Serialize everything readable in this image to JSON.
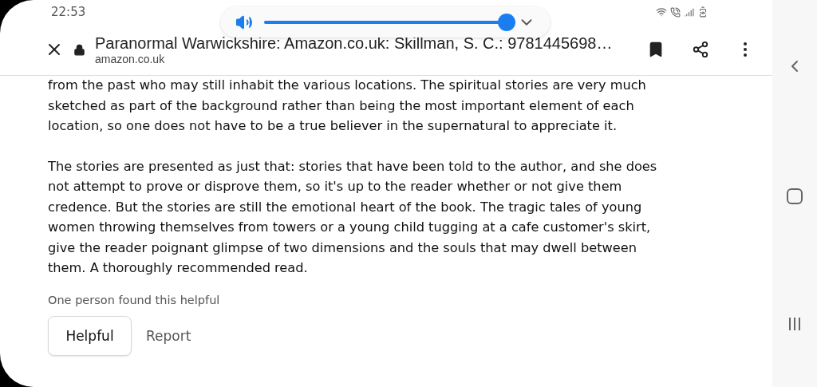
{
  "status_bar": {
    "time": "22:53"
  },
  "volume_popup": {
    "level": 1.0
  },
  "toolbar": {
    "title": "Paranormal Warwickshire: Amazon.co.uk: Skillman, S. C.: 9781445698…",
    "domain": "amazon.co.uk"
  },
  "review": {
    "paragraphs": [
      "from the past who may still inhabit the various locations. The spiritual stories are very much sketched as part of the background rather than being the most important element of each location, so one does not have to be a true believer in the supernatural to appreciate it.",
      "The stories are presented as just that: stories that have been told to the author, and she does not attempt to prove or disprove them, so it's up to the reader whether or not give them credence. But the stories are still the emotional heart of the book. The tragic tales of young women throwing themselves from towers or a young child tugging at a cafe customer's skirt, give the reader poignant glimpse of two dimensions and the souls that may dwell between them. A thoroughly recommended read."
    ],
    "helpful_count": "One person found this helpful",
    "helpful_button": "Helpful",
    "report_link": "Report"
  }
}
